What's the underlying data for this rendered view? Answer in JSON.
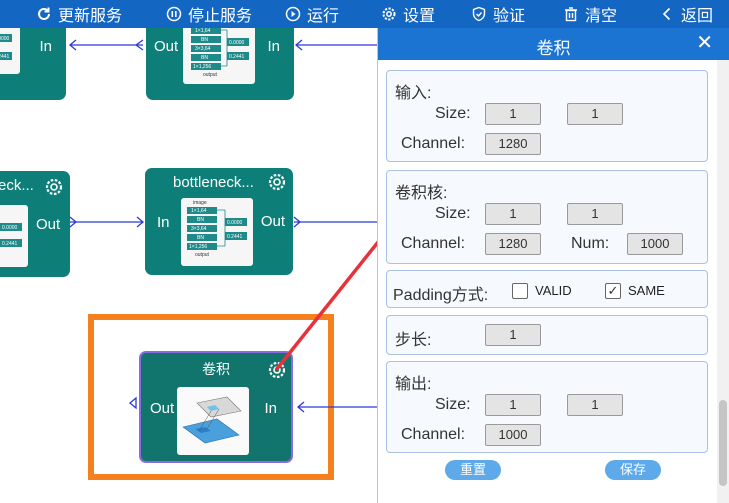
{
  "toolbar": {
    "update_service": "更新服务",
    "stop_service": "停止服务",
    "run": "运行",
    "settings": "设置",
    "validate": "验证",
    "clear": "清空",
    "back": "返回"
  },
  "canvas": {
    "node_top_right": {
      "in": "In",
      "out": "Out"
    },
    "node_top_left": {
      "in": "In"
    },
    "node_mid_left": {
      "title": "eck...",
      "out": "Out"
    },
    "node_mid_right": {
      "title": "bottleneck...",
      "in": "In",
      "out": "Out"
    },
    "node_conv": {
      "title": "卷积",
      "in": "In",
      "out": "Out"
    },
    "thumb_text": {
      "image": "image",
      "output": "output",
      "r1": "1×1,64",
      "r2": "BN",
      "r3": "3×3,64",
      "r4": "BN",
      "r5": "1×1,256",
      "v1": "0.0000",
      "v2": "0.2441"
    }
  },
  "panel": {
    "title": "卷积",
    "close": "✕",
    "input": {
      "heading": "输入:",
      "size_label": "Size:",
      "size_w": "1",
      "size_h": "1",
      "channel_label": "Channel:",
      "channel": "1280"
    },
    "kernel": {
      "heading": "卷积核:",
      "size_label": "Size:",
      "size_w": "1",
      "size_h": "1",
      "channel_label": "Channel:",
      "channel": "1280",
      "num_label": "Num:",
      "num": "1000"
    },
    "padding": {
      "label": "Padding方式:",
      "valid": "VALID",
      "same": "SAME",
      "selected": "SAME"
    },
    "stride": {
      "label": "步长:",
      "value": "1"
    },
    "output": {
      "heading": "输出:",
      "size_label": "Size:",
      "size_w": "1",
      "size_h": "1",
      "channel_label": "Channel:",
      "channel": "1000"
    },
    "reset": "重置",
    "save": "保存"
  },
  "colors": {
    "toolbar": "#1466c3",
    "node": "#0e7f78",
    "selection": "#f5801f",
    "arrow": "#e8323a",
    "edge": "#2b3bd6"
  }
}
